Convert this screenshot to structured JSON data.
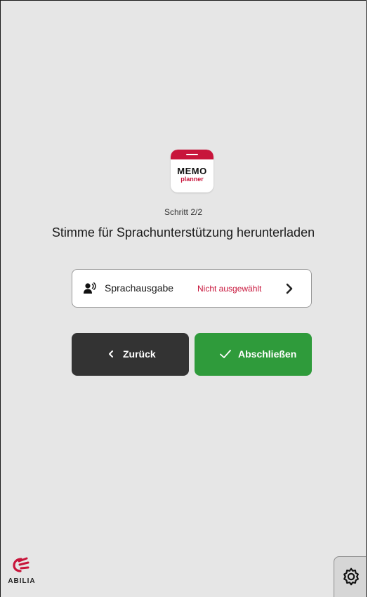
{
  "app_logo": {
    "line1": "MEMO",
    "line2": "planner",
    "brand_color": "#c8153b"
  },
  "step": {
    "label": "Schritt 2/2"
  },
  "title": "Stimme für Sprachunterstützung herunterladen",
  "setting": {
    "icon": "speaking-person-icon",
    "label": "Sprachausgabe",
    "value": "Nicht ausgewählt",
    "value_color": "#c8153b"
  },
  "buttons": {
    "back": {
      "label": "Zurück",
      "icon": "chevron-left-icon",
      "color": "#333333"
    },
    "finish": {
      "label": "Abschließen",
      "icon": "checkmark-icon",
      "color": "#2f9b3b"
    }
  },
  "footer": {
    "brand": "ABILIA",
    "settings_icon": "gear-icon"
  },
  "colors": {
    "background": "#e6e6e6",
    "accent": "#c8153b"
  }
}
